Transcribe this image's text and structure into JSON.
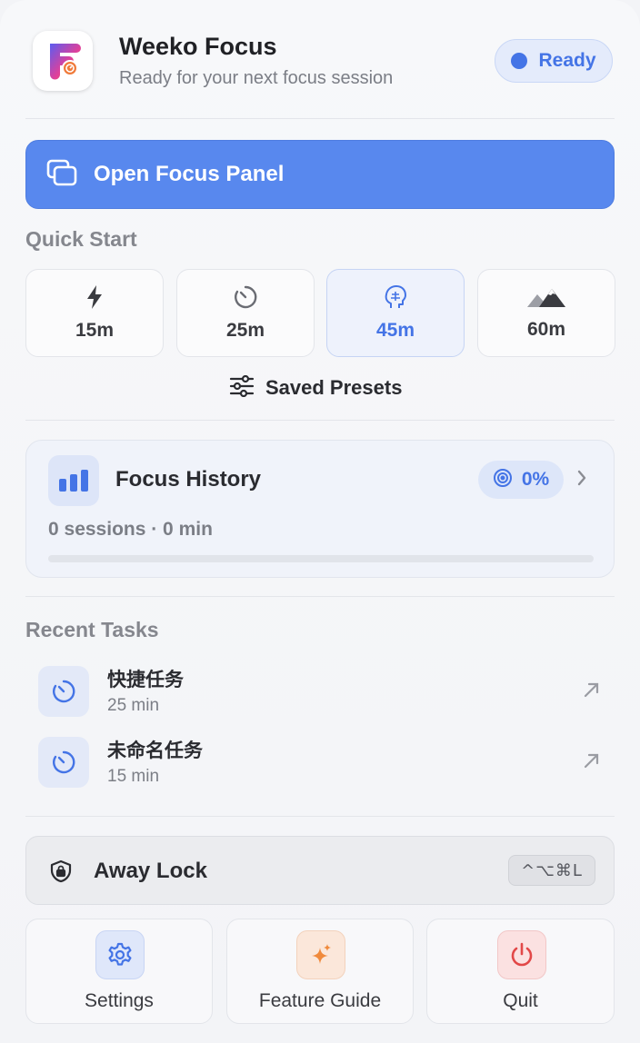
{
  "header": {
    "app_title": "Weeko Focus",
    "subtitle": "Ready for your next focus session",
    "status_label": "Ready",
    "accent_color": "#4474e6"
  },
  "open_panel": {
    "label": "Open Focus Panel"
  },
  "quick_start": {
    "title": "Quick Start",
    "options": [
      {
        "label": "15m",
        "icon": "bolt-icon"
      },
      {
        "label": "25m",
        "icon": "timer-icon"
      },
      {
        "label": "45m",
        "icon": "brain-icon",
        "selected": true
      },
      {
        "label": "60m",
        "icon": "mountain-icon"
      }
    ],
    "presets_label": "Saved Presets"
  },
  "history": {
    "title": "Focus History",
    "badge": "0%",
    "stats": "0 sessions · 0 min",
    "progress": 0
  },
  "recent_tasks": {
    "title": "Recent Tasks",
    "items": [
      {
        "name": "快捷任务",
        "duration": "25 min"
      },
      {
        "name": "未命名任务",
        "duration": "15 min"
      }
    ]
  },
  "away_lock": {
    "label": "Away Lock",
    "shortcut": "^⌥⌘L"
  },
  "footer": {
    "settings": "Settings",
    "guide": "Feature Guide",
    "quit": "Quit"
  }
}
